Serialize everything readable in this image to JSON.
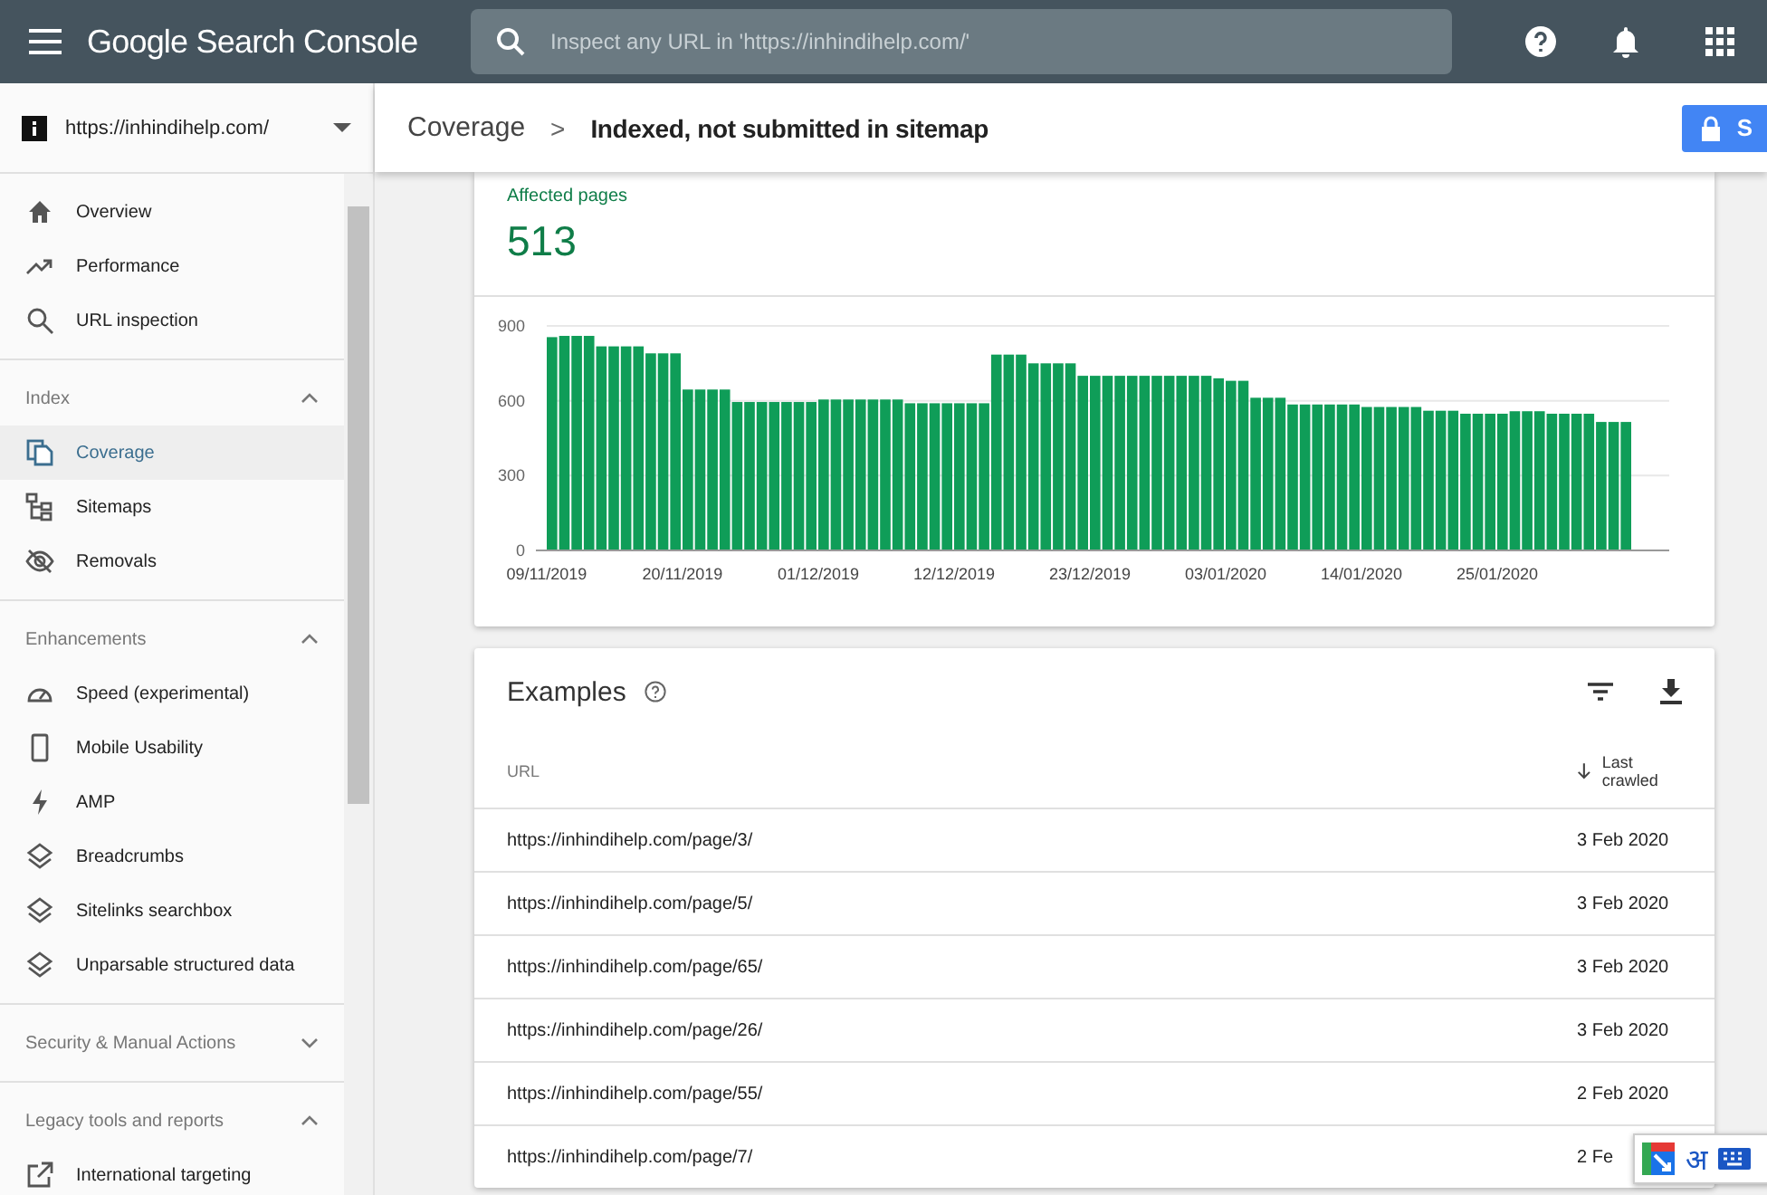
{
  "app_bar": {
    "product": "Google Search Console",
    "search_placeholder": "Inspect any URL in 'https://inhindihelp.com/'"
  },
  "property": {
    "label": "https://inhindihelp.com/"
  },
  "breadcrumb": {
    "parent": "Coverage",
    "separator": ">",
    "current": "Indexed, not submitted in sitemap",
    "share_button": "S"
  },
  "sidebar": {
    "sections": [
      {
        "items": [
          {
            "label": "Overview",
            "selected": false
          },
          {
            "label": "Performance",
            "selected": false
          },
          {
            "label": "URL inspection",
            "selected": false
          }
        ]
      },
      {
        "title": "Index",
        "expanded": true,
        "items": [
          {
            "label": "Coverage",
            "selected": true
          },
          {
            "label": "Sitemaps",
            "selected": false
          },
          {
            "label": "Removals",
            "selected": false
          }
        ]
      },
      {
        "title": "Enhancements",
        "expanded": true,
        "items": [
          {
            "label": "Speed (experimental)",
            "selected": false
          },
          {
            "label": "Mobile Usability",
            "selected": false
          },
          {
            "label": "AMP",
            "selected": false
          },
          {
            "label": "Breadcrumbs",
            "selected": false
          },
          {
            "label": "Sitelinks searchbox",
            "selected": false
          },
          {
            "label": "Unparsable structured data",
            "selected": false
          }
        ]
      },
      {
        "title": "Security & Manual Actions",
        "expanded": false
      },
      {
        "title": "Legacy tools and reports",
        "expanded": true,
        "items": [
          {
            "label": "International targeting",
            "selected": false
          }
        ]
      }
    ]
  },
  "summary": {
    "label": "Affected pages",
    "value": "513"
  },
  "chart_data": {
    "type": "bar",
    "yticks": [
      0,
      300,
      600,
      900
    ],
    "ylim": [
      0,
      900
    ],
    "categories": [
      "09/11/2019",
      null,
      null,
      null,
      null,
      null,
      null,
      null,
      null,
      null,
      null,
      "20/11/2019",
      null,
      null,
      null,
      null,
      null,
      null,
      null,
      null,
      null,
      null,
      "01/12/2019",
      null,
      null,
      null,
      null,
      null,
      null,
      null,
      null,
      null,
      null,
      "12/12/2019",
      null,
      null,
      null,
      null,
      null,
      null,
      null,
      null,
      null,
      null,
      "23/12/2019",
      null,
      null,
      null,
      null,
      null,
      null,
      null,
      null,
      null,
      null,
      "03/01/2020",
      null,
      null,
      null,
      null,
      null,
      null,
      null,
      null,
      null,
      null,
      "14/01/2020",
      null,
      null,
      null,
      null,
      null,
      null,
      null,
      null,
      null,
      null,
      "25/01/2020",
      null,
      null,
      null,
      null,
      null,
      null,
      null,
      null,
      null,
      null
    ],
    "series": [
      {
        "color": "#0f9d58",
        "values": [
          855,
          860,
          860,
          860,
          818,
          818,
          818,
          818,
          790,
          790,
          790,
          645,
          645,
          645,
          645,
          595,
          595,
          595,
          595,
          595,
          595,
          595,
          605,
          605,
          605,
          605,
          605,
          605,
          605,
          590,
          590,
          590,
          590,
          590,
          590,
          590,
          785,
          785,
          785,
          750,
          750,
          750,
          750,
          700,
          700,
          700,
          700,
          700,
          700,
          700,
          700,
          700,
          700,
          700,
          690,
          680,
          680,
          612,
          612,
          612,
          585,
          585,
          585,
          585,
          585,
          585,
          575,
          575,
          575,
          575,
          575,
          560,
          560,
          560,
          548,
          548,
          548,
          548,
          558,
          558,
          558,
          548,
          548,
          548,
          548,
          515,
          515,
          515
        ]
      }
    ]
  },
  "examples": {
    "title": "Examples",
    "columns": [
      {
        "label": "URL",
        "sorted": false
      },
      {
        "label": "Last crawled",
        "sorted": true
      }
    ],
    "rows": [
      [
        "https://inhindihelp.com/page/3/",
        "3 Feb 2020"
      ],
      [
        "https://inhindihelp.com/page/5/",
        "3 Feb 2020"
      ],
      [
        "https://inhindihelp.com/page/65/",
        "3 Feb 2020"
      ],
      [
        "https://inhindihelp.com/page/26/",
        "3 Feb 2020"
      ],
      [
        "https://inhindihelp.com/page/55/",
        "2 Feb 2020"
      ],
      [
        "https://inhindihelp.com/page/7/",
        "2 Fe"
      ]
    ]
  },
  "input_tools": {
    "script_glyph": "अ"
  }
}
